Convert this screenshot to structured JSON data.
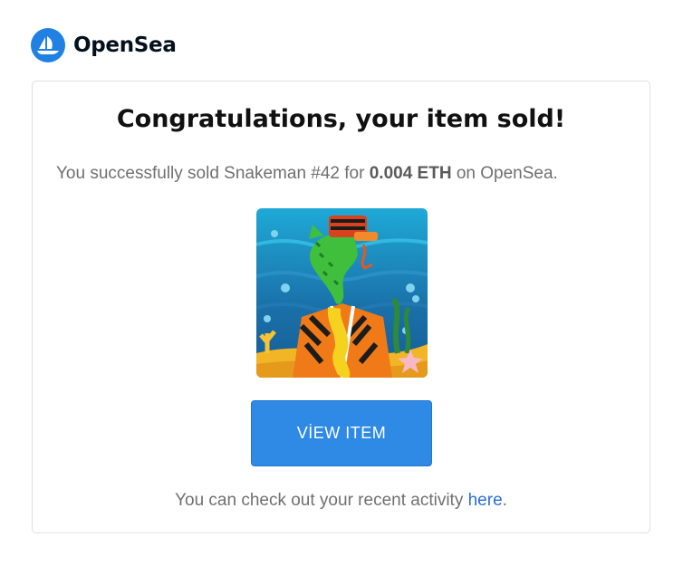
{
  "brand": {
    "name": "OpenSea",
    "icon": "opensea-logo-icon",
    "color": "#2081e2"
  },
  "email": {
    "title": "Congratulations, your item sold!",
    "sold_prefix": "You successfully sold Snakeman #42 for ",
    "price": "0.004 ETH",
    "sold_suffix": " on OpenSea.",
    "item_image": "snakeman-42-nft-image",
    "button_label": "VİEW ITEM",
    "activity_prefix": "You can check out your recent activity ",
    "activity_link": "here",
    "activity_suffix": ".",
    "button_color": "#2f8ae6",
    "link_color": "#2a6fd6"
  }
}
